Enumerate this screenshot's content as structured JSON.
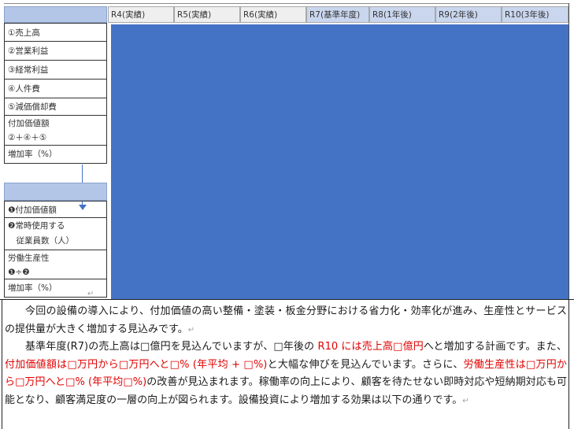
{
  "columns": [
    "R4(実績)",
    "R5(実績)",
    "R6(実績)",
    "R7(基準年度)",
    "R8(1年後)",
    "R9(2年後)",
    "R10(3年後)"
  ],
  "table1": {
    "rows": [
      {
        "lines": [
          "①売上高"
        ]
      },
      {
        "lines": [
          "②営業利益"
        ]
      },
      {
        "lines": [
          "③経常利益"
        ]
      },
      {
        "lines": [
          "④人件費"
        ]
      },
      {
        "lines": [
          "⑤減価償却費"
        ]
      },
      {
        "lines": [
          "付加価値額",
          "②＋④＋⑤"
        ]
      },
      {
        "lines": [
          "増加率（%）"
        ]
      }
    ]
  },
  "table2": {
    "rows": [
      {
        "lines": [
          "❶付加価値額"
        ]
      },
      {
        "lines": [
          "❷常時使用する",
          "　従業員数（人）"
        ]
      },
      {
        "lines": [
          "労働生産性",
          "❶÷❷"
        ]
      },
      {
        "lines": [
          "増加率（%）"
        ]
      }
    ]
  },
  "paragraph1": {
    "text": "今回の設備の導入により、付加価値の高い整備・塗装・板金分野における省力化・効率化が進み、生産性とサービスの提供量が大きく増加する見込みです。"
  },
  "paragraph2": {
    "p1": "基準年度(R7)の売上高は",
    "p1b": "億円を見込んでいますが、",
    "p1c": "年後の ",
    "red1": "R10 には売上高",
    "red1b": "億円",
    "p2": "へと増加する計画です。また、",
    "red2": "付加価値額は",
    "red2b": "万円から",
    "red2c": "万円へと",
    "red2d": "% (年平均 + ",
    "red2e": "%)",
    "p3": "と大幅な伸びを見込んでいます。さらに、",
    "red3": "労働生産性は",
    "red3b": "万円から",
    "red3c": "万円へと",
    "red3d": "% (年平均",
    "red3e": "%)",
    "p4": "の改善が見込まれます。稼働率の向上により、顧客を待たせない即時対応や短納期対応も可能となり、顧客満足度の一層の向上が図られます。設備投資により増加する効果は以下の通りです。"
  },
  "placeholder_glyph": "□",
  "return_mark": "↵",
  "colors": {
    "blue_fill": "#4472c4",
    "header_blue": "#b4c6e7",
    "red_text": "#e00000"
  }
}
